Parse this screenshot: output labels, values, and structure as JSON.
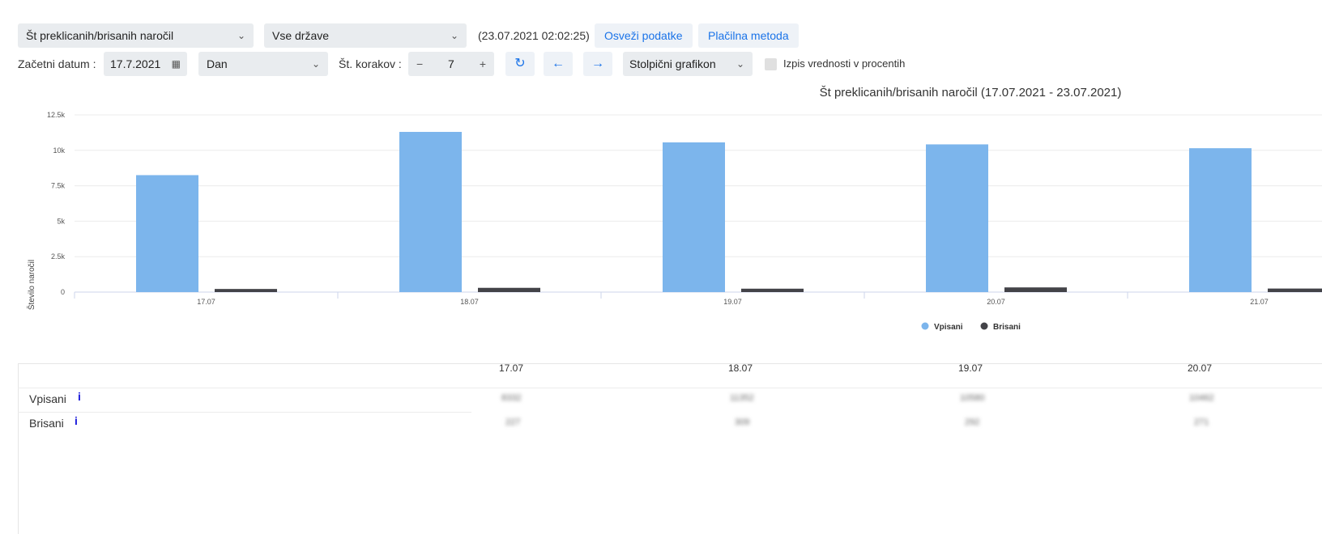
{
  "toolbar": {
    "metric_select": "Št preklicanih/brisanih naročil",
    "country_select": "Vse države",
    "timestamp": "(23.07.2021 02:02:25)",
    "refresh_label": "Osveži podatke",
    "payment_label": "Plačilna metoda"
  },
  "controls": {
    "start_label": "Začetni datum :",
    "start_date": "17.7.2021",
    "period_select": "Dan",
    "steps_label": "Št. korakov :",
    "steps_value": "7",
    "chart_type_select": "Stolpični grafikon",
    "percent_label": "Izpis vrednosti v procentih"
  },
  "chart_data": {
    "type": "bar",
    "title": "Št preklicanih/brisanih naročil (17.07.2021 - 23.07.2021)",
    "ylabel": "Število naročil",
    "categories": [
      "17.07",
      "18.07",
      "19.07",
      "20.07",
      "21.07"
    ],
    "ylim": [
      0,
      12500
    ],
    "yticks": [
      "0",
      "2.5k",
      "5k",
      "7.5k",
      "10k",
      "12.5k"
    ],
    "series": [
      {
        "name": "Vpisani",
        "color": "#7cb5ec",
        "values": [
          8250,
          11300,
          10560,
          10420,
          10150
        ]
      },
      {
        "name": "Brisani",
        "color": "#434348",
        "values": [
          220,
          300,
          240,
          330,
          250
        ]
      }
    ],
    "legend_position": "bottom-center",
    "grid": true
  },
  "table": {
    "columns": [
      "17.07",
      "18.07",
      "19.07",
      "20.07"
    ],
    "rows": [
      {
        "label": "Vpisani",
        "info": "i",
        "values": [
          "8332",
          "11352",
          "10580",
          "10462"
        ]
      },
      {
        "label": "Brisani",
        "info": "i",
        "values": [
          "227",
          "309",
          "292",
          "271"
        ]
      }
    ]
  }
}
